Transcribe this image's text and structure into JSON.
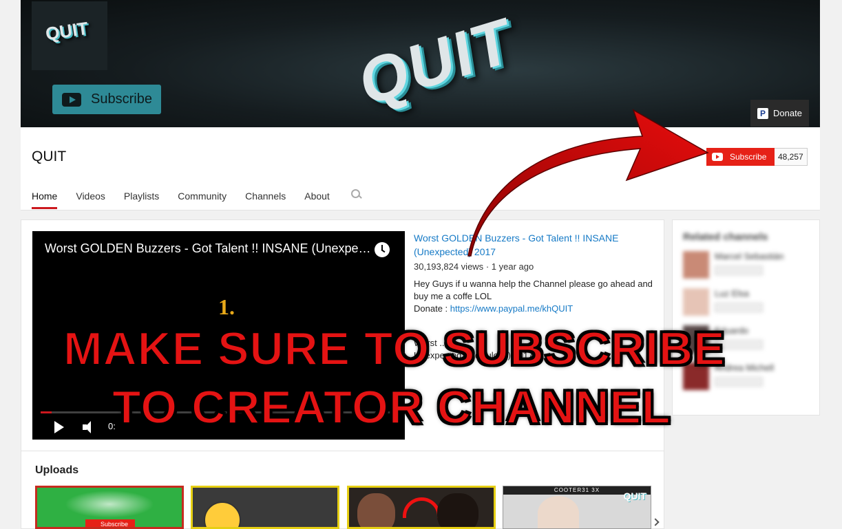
{
  "banner": {
    "logo_text": "QUIT",
    "avatar_text": "QUIT",
    "subscribe_label": "Subscribe",
    "donate_label": "Donate",
    "paypal_glyph": "P"
  },
  "channel": {
    "name": "QUIT",
    "subscribe_label": "Subscribe",
    "subscriber_count": "48,257",
    "tabs": [
      "Home",
      "Videos",
      "Playlists",
      "Community",
      "Channels",
      "About"
    ],
    "active_tab": "Home"
  },
  "featured": {
    "player_title": "Worst GOLDEN Buzzers - Got Talent !! INSANE (Unexpected) 2017",
    "rank_text": "1.",
    "time_text": "0:",
    "title": "Worst GOLDEN Buzzers - Got Talent !! INSANE (Unexpected) 2017",
    "views": "30,193,824 views",
    "age": "1 year ago",
    "desc_line1": "Hey Guys if u wanna help the Channel please go ahead and buy me a coffe LOL",
    "desc_donate_prefix": "Donate : ",
    "desc_donate_link": "https://www.paypal.me/khQUIT",
    "extra_line1": "Worst ...",
    "extra_line2": "Unexpected, Ridiculous) 2017"
  },
  "related": {
    "heading": "Related channels",
    "items": [
      {
        "name": "Marcel Sebastián",
        "button": "Subscribe"
      },
      {
        "name": "Luz Elsa",
        "button": "Subscribe"
      },
      {
        "name": "Eduardo",
        "button": "Subscribe"
      },
      {
        "name": "Andrea Michell",
        "button": "Subscribe"
      }
    ]
  },
  "uploads": {
    "heading": "Uploads",
    "thumb1_sub": "Subscribe",
    "thumb4_bar": "COOTER31 3X",
    "thumb4_logo": "QUIT"
  },
  "overlay": {
    "line1": "MAKE SURE TO SUBSCRIBE",
    "line2": "TO CREATOR CHANNEL",
    "color": "#e41313"
  },
  "colors": {
    "youtube_red": "#e62117",
    "link_blue": "#167ac6",
    "active_tab_underline": "#cc181e"
  },
  "icons": [
    "youtube-play-icon",
    "paypal-icon",
    "search-icon",
    "clock-icon",
    "play-icon",
    "volume-icon",
    "chevron-right-icon"
  ]
}
